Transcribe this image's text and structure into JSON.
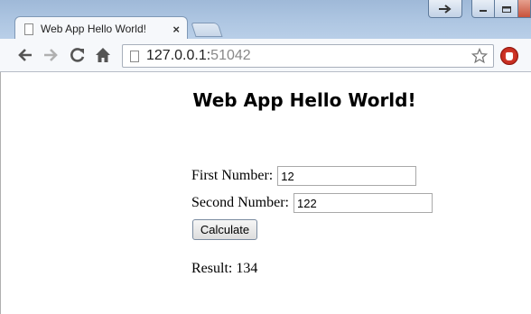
{
  "browser": {
    "tab": {
      "title": "Web App Hello World!",
      "close_glyph": "×"
    },
    "address": {
      "host": "127.0.0.1:",
      "port": "51042"
    },
    "icons": {
      "back": "back-arrow-icon",
      "forward": "forward-arrow-icon",
      "reload": "reload-icon",
      "home": "home-icon",
      "bookmark": "star-icon",
      "extension": "stop-hand-icon"
    }
  },
  "page": {
    "heading": "Web App Hello World!",
    "first_number": {
      "label": "First Number:",
      "value": "12"
    },
    "second_number": {
      "label": "Second Number:",
      "value": "122"
    },
    "calculate_label": "Calculate",
    "result_label": "Result:",
    "result_value": "134"
  }
}
